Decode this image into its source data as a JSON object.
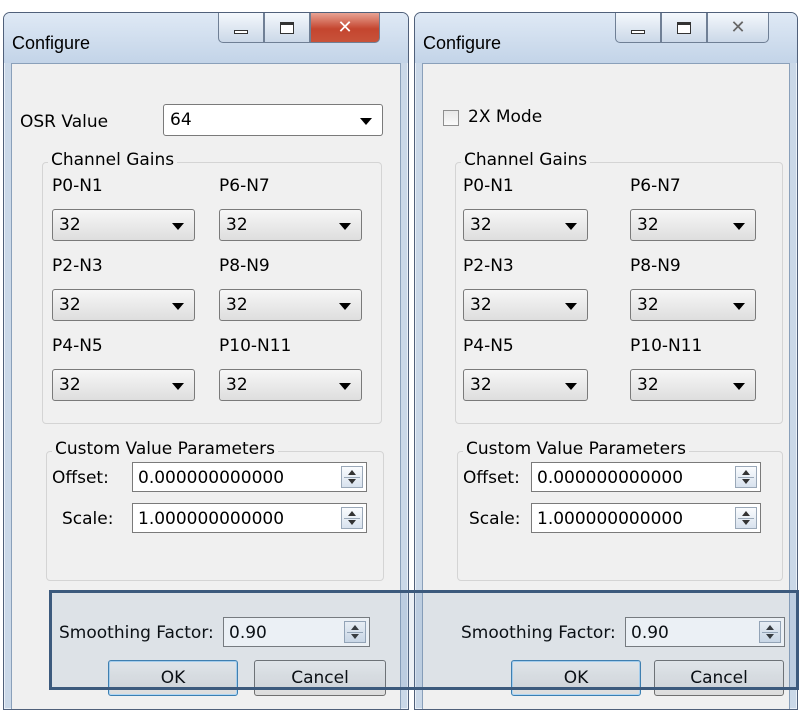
{
  "left_dialog": {
    "title": "Configure",
    "osr_label": "OSR Value",
    "osr_value": "64",
    "channel_gains_title": "Channel Gains",
    "gains": [
      {
        "label": "P0-N1",
        "value": "32"
      },
      {
        "label": "P6-N7",
        "value": "32"
      },
      {
        "label": "P2-N3",
        "value": "32"
      },
      {
        "label": "P8-N9",
        "value": "32"
      },
      {
        "label": "P4-N5",
        "value": "32"
      },
      {
        "label": "P10-N11",
        "value": "32"
      }
    ],
    "custom_title": "Custom Value Parameters",
    "offset_label": "Offset:",
    "offset_value": "0.000000000000",
    "scale_label": "Scale:",
    "scale_value": "1.000000000000",
    "smoothing_label": "Smoothing Factor:",
    "smoothing_value": "0.90",
    "ok_label": "OK",
    "cancel_label": "Cancel"
  },
  "right_dialog": {
    "title": "Configure",
    "mode_label": "2X Mode",
    "mode_checked": false,
    "channel_gains_title": "Channel Gains",
    "gains": [
      {
        "label": "P0-N1",
        "value": "32"
      },
      {
        "label": "P6-N7",
        "value": "32"
      },
      {
        "label": "P2-N3",
        "value": "32"
      },
      {
        "label": "P8-N9",
        "value": "32"
      },
      {
        "label": "P4-N5",
        "value": "32"
      },
      {
        "label": "P10-N11",
        "value": "32"
      }
    ],
    "custom_title": "Custom Value Parameters",
    "offset_label": "Offset:",
    "offset_value": "0.000000000000",
    "scale_label": "Scale:",
    "scale_value": "1.000000000000",
    "smoothing_label": "Smoothing Factor:",
    "smoothing_value": "0.90",
    "ok_label": "OK",
    "cancel_label": "Cancel"
  },
  "colors": {
    "highlight_border": "#3c5a7d",
    "close_button_active": "#c4452f",
    "window_frame": "#cad8e8"
  }
}
